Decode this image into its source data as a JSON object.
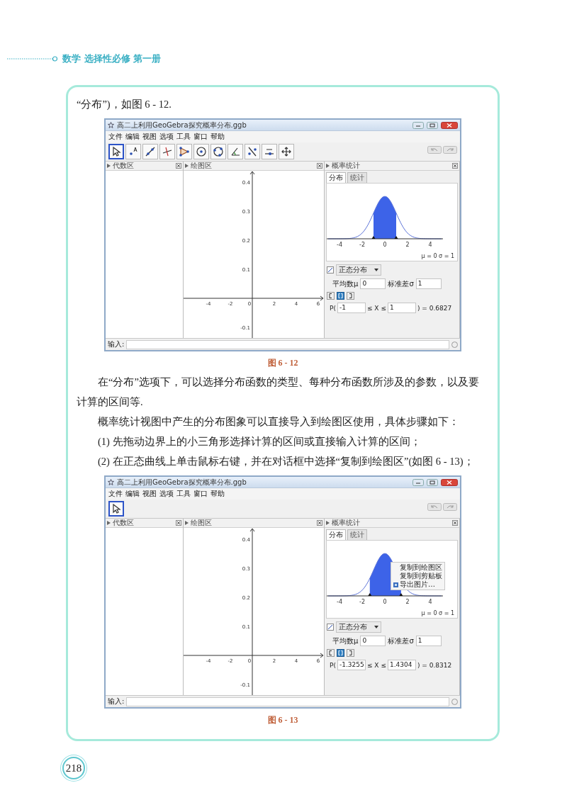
{
  "header": {
    "subject": "数学 选择性必修 第一册"
  },
  "blocks": [
    {
      "kind": "continuation",
      "text": "“分布”)，如图 6 - 12."
    },
    {
      "kind": "figure",
      "caption": "图 6 - 12",
      "window": {
        "title": "高二上利用GeoGebra探究概率分布.ggb",
        "menu": [
          "文件",
          "编辑",
          "视图",
          "选项",
          "工具",
          "窗口",
          "帮助"
        ],
        "tools": [
          {
            "kind": "pointer",
            "selected": true
          },
          {
            "kind": "point",
            "selected": false
          },
          {
            "kind": "line",
            "selected": false
          },
          {
            "kind": "perpendicular",
            "selected": false
          },
          {
            "kind": "polygon",
            "selected": false
          },
          {
            "kind": "circle",
            "selected": false
          },
          {
            "kind": "circle3",
            "selected": false
          },
          {
            "kind": "angle",
            "selected": false
          },
          {
            "kind": "reflect",
            "selected": false
          },
          {
            "kind": "slider",
            "selected": false
          },
          {
            "kind": "move",
            "selected": false
          }
        ],
        "algebra_title": "代数区",
        "graphics": {
          "title": "绘图区",
          "xticks": [
            "-4",
            "-2",
            "0",
            "2",
            "4",
            "6"
          ],
          "yticks": [
            "0.4",
            "0.3",
            "0.2",
            "0.1",
            "-0.1"
          ]
        },
        "prob": {
          "title": "概率统计",
          "tabs": [
            {
              "label": "分布",
              "selected": true
            },
            {
              "label": "统计",
              "selected": false
            }
          ],
          "curve_ticks": [
            "-4",
            "-2",
            "0",
            "2",
            "4"
          ],
          "summary": "μ = 0   σ = 1",
          "distribution": "正态分布",
          "mean_label": "平均数μ",
          "mean": "0",
          "sd_label": "标准差σ",
          "sd": "1",
          "interval_modes": [
            {
              "kind": "left",
              "selected": false
            },
            {
              "kind": "both",
              "selected": true
            },
            {
              "kind": "right",
              "selected": false
            }
          ],
          "p_open": "P(",
          "lower": "-1",
          "between": "≤ X ≤",
          "upper": "1",
          "result": ") = 0.6827"
        },
        "input_label": "输入:"
      }
    },
    {
      "kind": "paragraph",
      "text": "在“分布”选项下，可以选择分布函数的类型、每种分布函数所涉及的参数，以及要计算的区间等."
    },
    {
      "kind": "paragraph",
      "text": "概率统计视图中产生的分布图象可以直接导入到绘图区使用，具体步骤如下："
    },
    {
      "kind": "paragraph",
      "text": "(1) 先拖动边界上的小三角形选择计算的区间或直接输入计算的区间；"
    },
    {
      "kind": "paragraph",
      "text": "(2) 在正态曲线上单击鼠标右键，并在对话框中选择“复制到绘图区”(如图 6 - 13)；"
    },
    {
      "kind": "figure",
      "caption": "图 6 - 13",
      "window": {
        "title": "高二上利用GeoGebra探究概率分布.ggb",
        "menu": [
          "文件",
          "编辑",
          "视图",
          "选项",
          "工具",
          "窗口",
          "帮助"
        ],
        "tools": [
          {
            "kind": "pointer",
            "selected": true
          }
        ],
        "algebra_title": "代数区",
        "graphics": {
          "title": "绘图区",
          "xticks": [
            "-4",
            "-2",
            "0",
            "2",
            "4",
            "6"
          ],
          "yticks": [
            "0.4",
            "0.3",
            "0.2",
            "0.1",
            "-0.1"
          ]
        },
        "prob": {
          "title": "概率统计",
          "tabs": [
            {
              "label": "分布",
              "selected": true
            },
            {
              "label": "统计",
              "selected": false
            }
          ],
          "curve_ticks": [
            "-4",
            "-2",
            "0",
            "2",
            "4"
          ],
          "summary": "μ = 0   σ = 1",
          "distribution": "正态分布",
          "mean_label": "平均数μ",
          "mean": "0",
          "sd_label": "标准差σ",
          "sd": "1",
          "interval_modes": [
            {
              "kind": "left",
              "selected": false
            },
            {
              "kind": "both",
              "selected": true
            },
            {
              "kind": "right",
              "selected": false
            }
          ],
          "p_open": "P(",
          "lower": "-1.3255",
          "between": "≤ X ≤",
          "upper": "1.4304",
          "result": ") = 0.8312",
          "context_menu": [
            {
              "kind": "plain",
              "label": "复制到绘图区"
            },
            {
              "kind": "plain",
              "label": "复制到剪贴板"
            },
            {
              "kind": "export",
              "label": "导出图片…"
            }
          ]
        },
        "input_label": "输入:"
      }
    }
  ],
  "page_number": "218"
}
